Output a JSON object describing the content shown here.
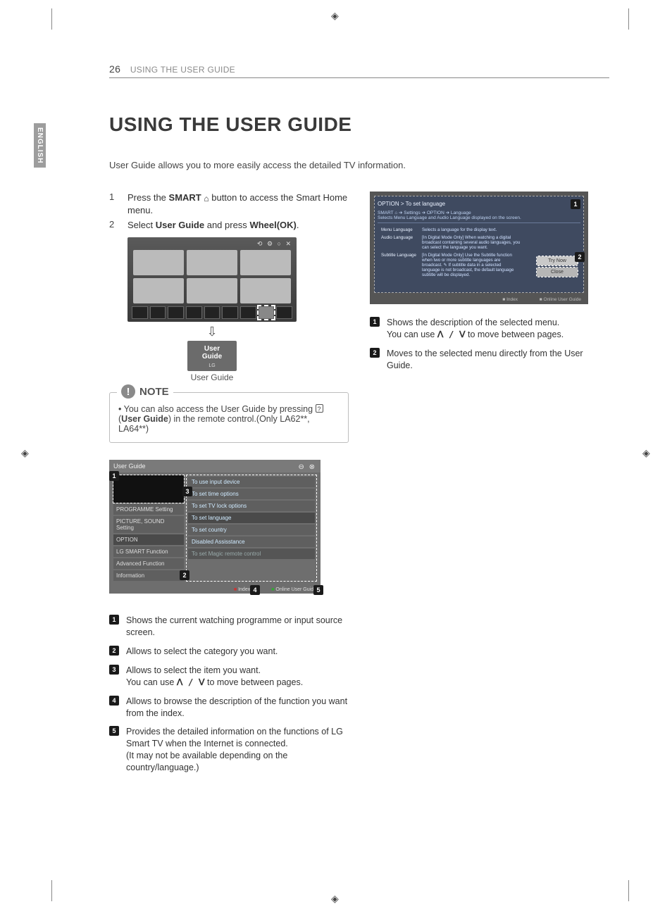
{
  "page": {
    "number": "26",
    "running_head": "USING THE USER GUIDE",
    "language_tab": "ENGLISH",
    "title": "USING THE USER GUIDE",
    "intro": "User Guide allows you to more easily access the detailed TV information."
  },
  "steps": {
    "s1_pre": "Press the ",
    "s1_smart": "SMART",
    "s1_post": " button to access the Smart Home menu.",
    "s2_pre": "Select ",
    "s2_ug": "User Guide",
    "s2_mid": " and press ",
    "s2_wheel": "Wheel(OK)",
    "s2_post": "."
  },
  "tile": {
    "line1": "User",
    "line2": "Guide",
    "brand": "LG",
    "caption": "User Guide"
  },
  "note": {
    "heading": "NOTE",
    "text_pre": "You can also access the User Guide by pressing ",
    "key_label": "?",
    "text_mid": "(",
    "text_ug": "User Guide",
    "text_post": ") in the remote control.(Only LA62**, LA64**)"
  },
  "shot2": {
    "header": "User Guide",
    "categories": [
      "PROGRAMME Setting",
      "PICTURE, SOUND Setting",
      "OPTION",
      "LG SMART Function",
      "Advanced Function",
      "Information"
    ],
    "items": [
      "To use input device",
      "To set time options",
      "To set TV lock options",
      "To set language",
      "To set country",
      "Disabled Assisstance",
      "To set Magic remote control"
    ],
    "footer_index": "Index",
    "footer_online": "Online User Guide"
  },
  "shot3": {
    "crumb": "OPTION > To set language",
    "sub_line1": "SMART ⌂ ➔ Settings ➔ OPTION ➔ Language",
    "sub_line2": "Selects Menu Language and Audio Language displayed on the screen.",
    "rows": [
      {
        "k": "Menu Language",
        "v": "Selects a language for the display text."
      },
      {
        "k": "Audio Language",
        "v": "[In Digital Mode Only] When watching a digital broadcast containing several audio languages, you can select the language you want."
      },
      {
        "k": "Subtitle Language",
        "v": "[In Digital Mode Only] Use the Subtitle function when two or more subtitle languages are broadcast. ✎ If subtitle data in a selected language is not broadcast, the default language subtitle will be displayed."
      }
    ],
    "btn_try": "Try Now",
    "btn_close": "Close",
    "foot_index": "Index",
    "foot_online": "Online User Guide"
  },
  "legend_left": {
    "i1": "Shows the current watching programme or input source screen.",
    "i2": "Allows to select the category you want.",
    "i3a": "Allows to select the item you want.",
    "i3b_pre": "You can use ",
    "i3b_post": " to move between pages.",
    "i4": "Allows to browse the description of the function you want from the index.",
    "i5a": "Provides the detailed information on the functions of LG Smart TV when the Internet is connected.",
    "i5b": "(It may not be available depending on the country/language.)"
  },
  "legend_right": {
    "i1a": "Shows the description of the selected menu.",
    "i1b_pre": "You can use ",
    "i1b_post": " to move between pages.",
    "i2": "Moves to the selected menu directly from the User Guide."
  },
  "glyphs": {
    "chevrons": "ꓥ / ꓦ",
    "home": "⌂"
  }
}
